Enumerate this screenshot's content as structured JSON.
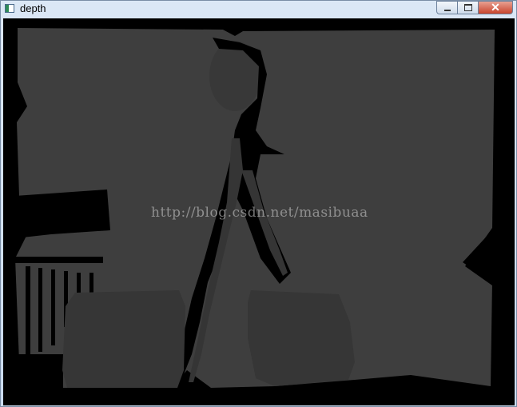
{
  "window": {
    "title": "depth",
    "icon": "opencv-window-icon"
  },
  "controls": {
    "minimize_icon": "minimize-icon",
    "maximize_icon": "maximize-icon",
    "close_icon": "close-icon",
    "close_glyph": "✕"
  },
  "image": {
    "content": "depth-map",
    "watermark": "http://blog.csdn.net/masibuaa"
  },
  "colors": {
    "background_depth": "#3d3d3d",
    "near_depth": "#363636",
    "no_data": "#000000"
  }
}
